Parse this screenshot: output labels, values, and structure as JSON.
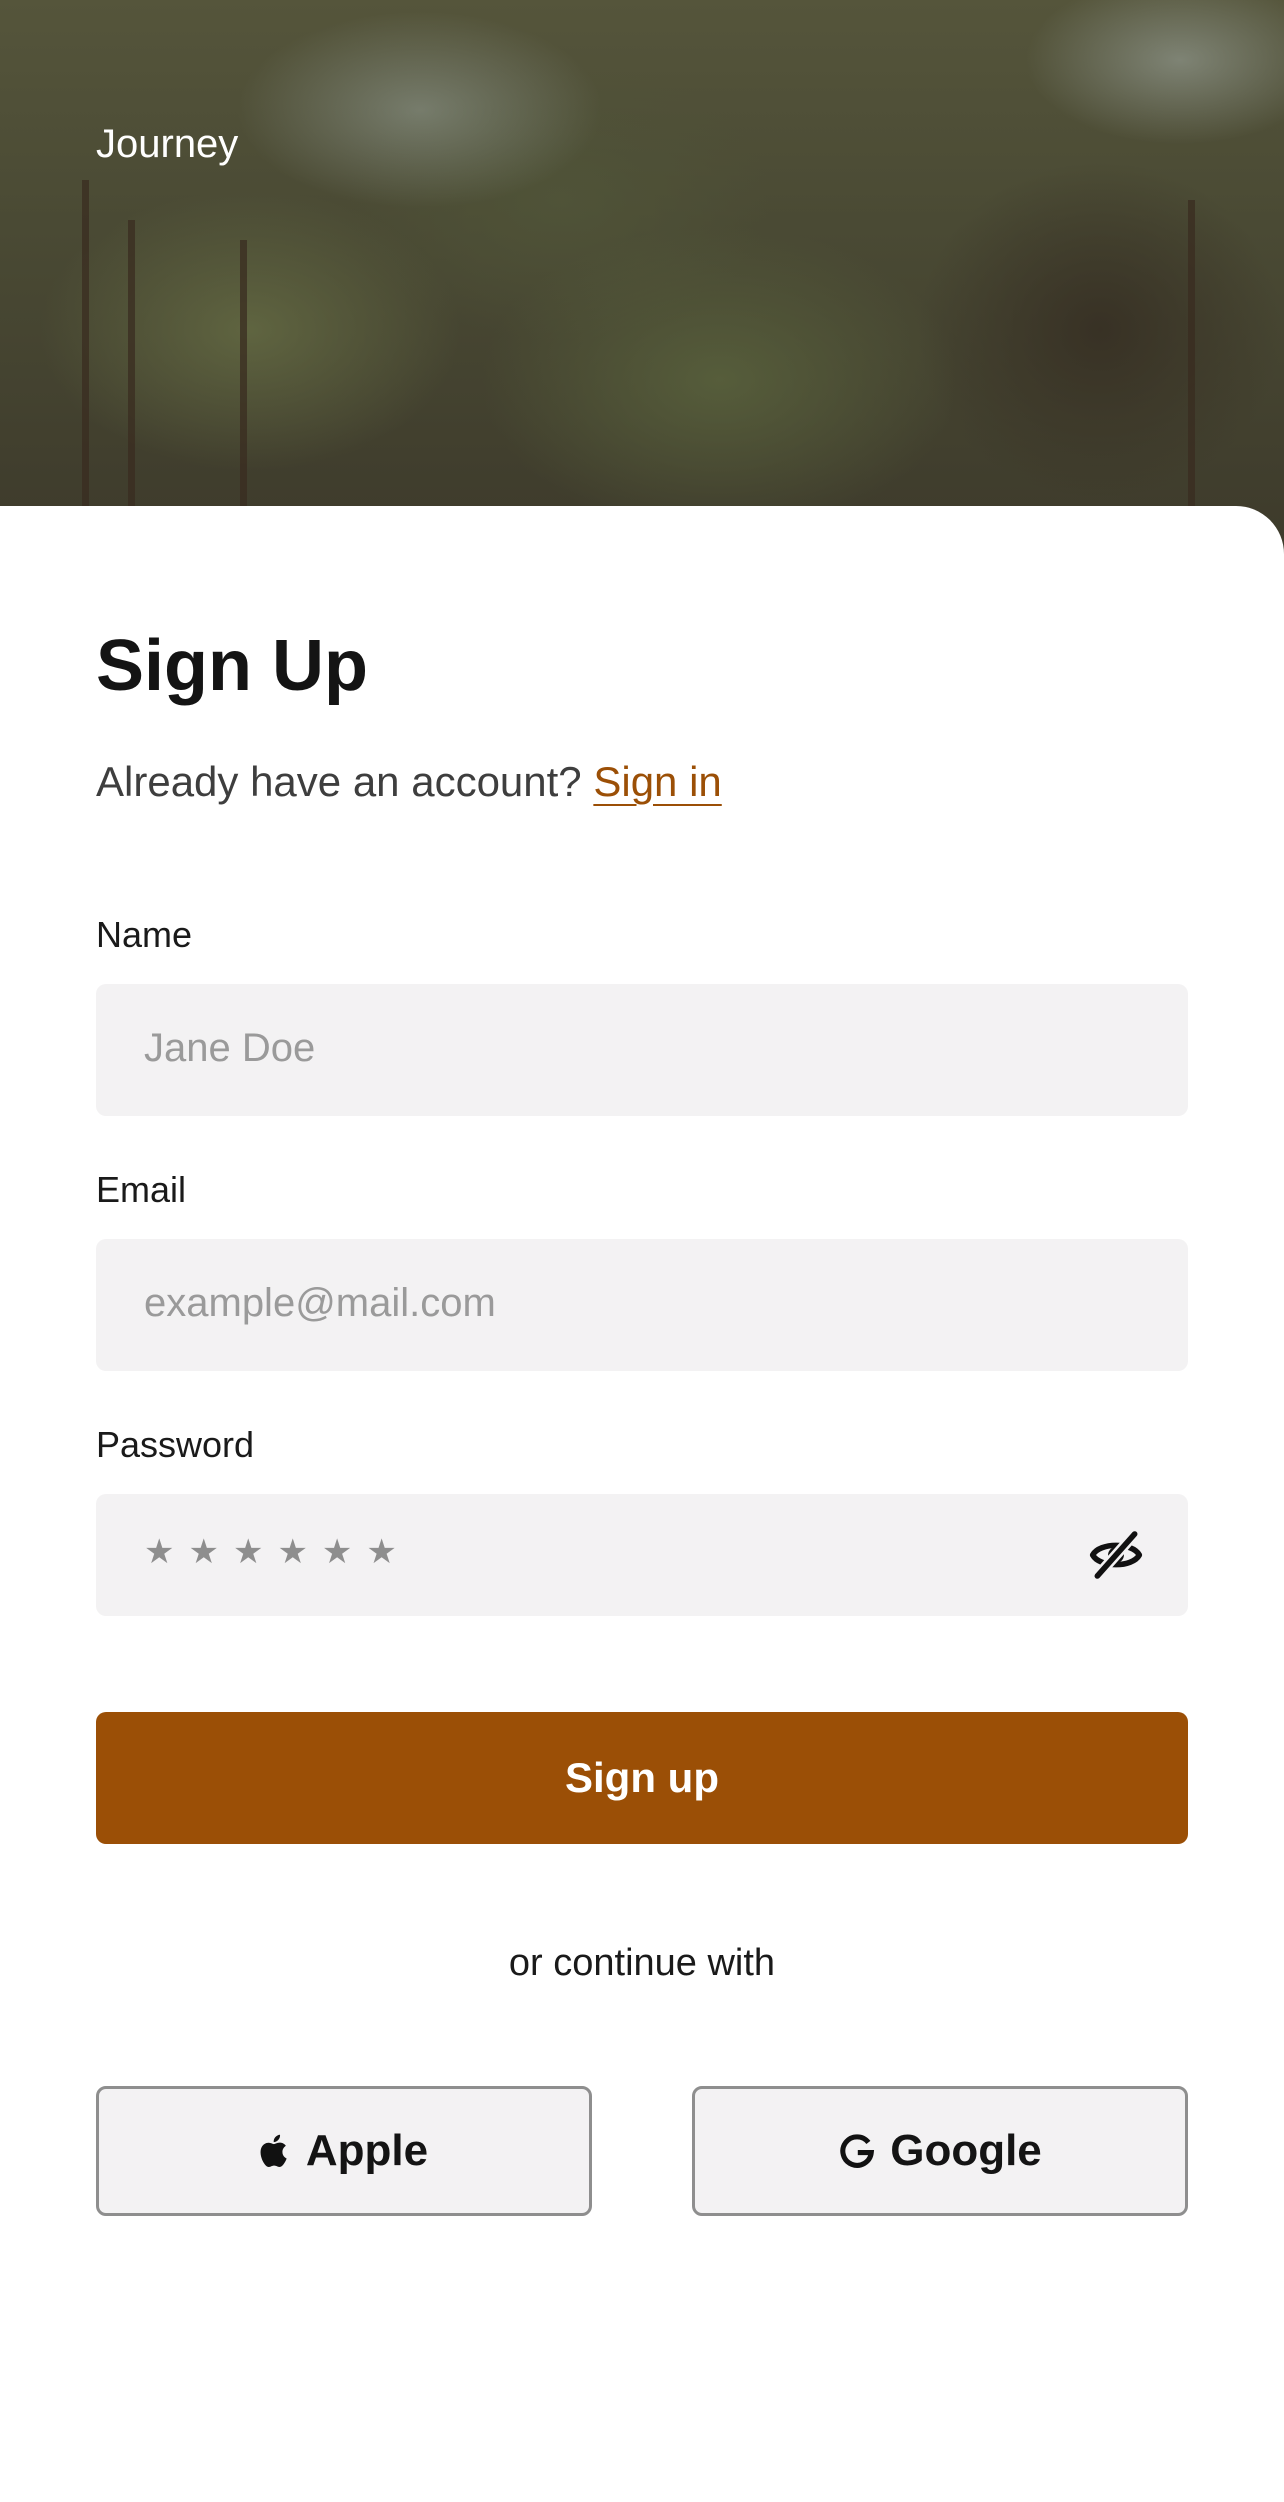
{
  "header": {
    "brand": "Journey"
  },
  "form": {
    "title": "Sign Up",
    "subtitle_prefix": "Already have an account?",
    "sign_in_link": "Sign in",
    "name": {
      "label": "Name",
      "placeholder": "Jane Doe"
    },
    "email": {
      "label": "Email",
      "placeholder": "example@mail.com"
    },
    "password": {
      "label": "Password",
      "masked_value": "★★★★★★",
      "toggle_icon": "eye-off-icon"
    },
    "submit_label": "Sign up",
    "divider_text": "or continue with",
    "social": [
      {
        "label": "Apple",
        "icon": "apple-icon"
      },
      {
        "label": "Google",
        "icon": "google-icon"
      }
    ]
  },
  "colors": {
    "accent": "#9b4f06",
    "field_bg": "#f3f2f3",
    "placeholder": "#9a9a9a"
  }
}
